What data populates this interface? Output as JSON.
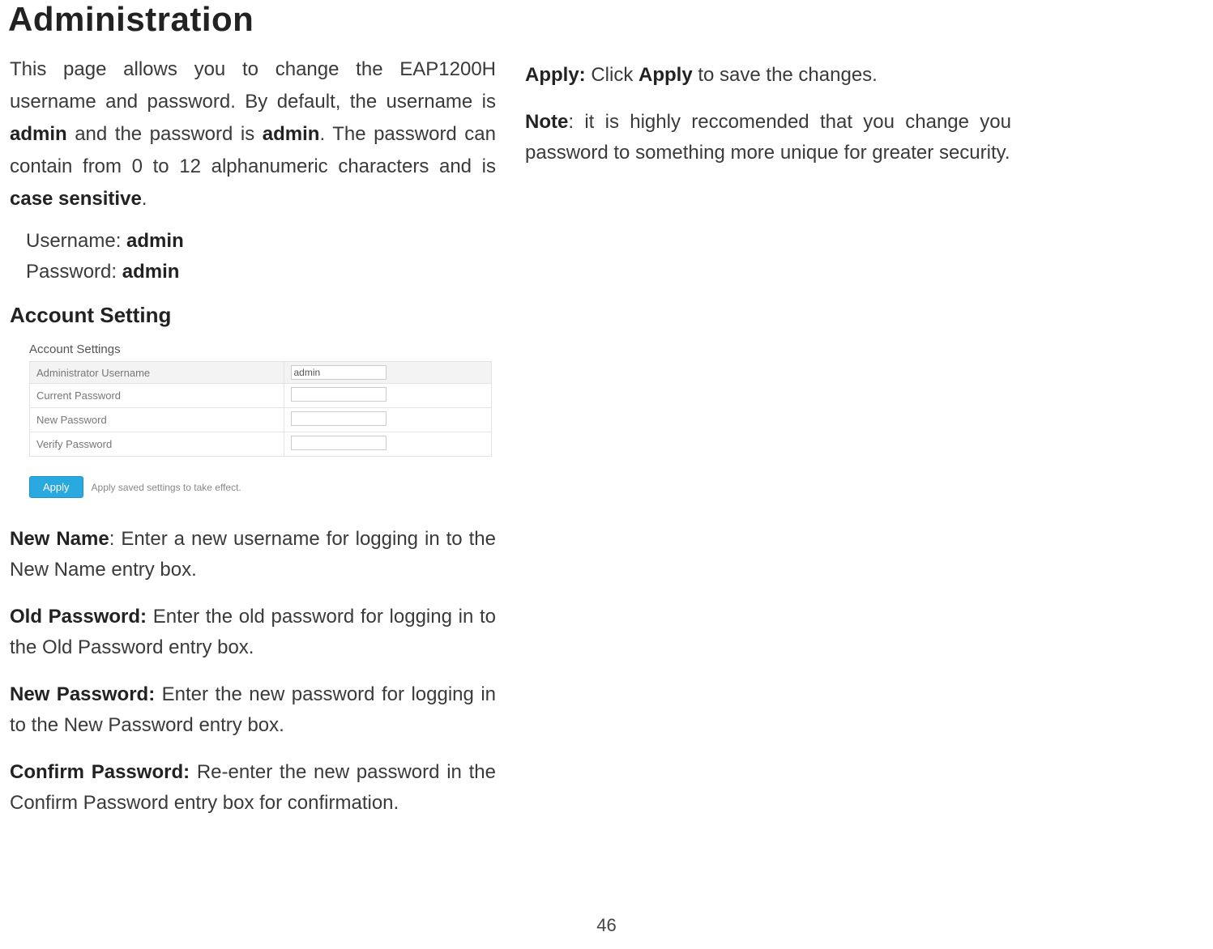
{
  "page": {
    "number": "46",
    "title": "Administration"
  },
  "intro": {
    "pre": "This page allows you to change the EAP1200H username and password. By default, the username is ",
    "b1": "admin",
    "mid1": " and the password is ",
    "b2": "admin",
    "mid2": ". The password can contain from 0 to 12 alphanumeric characters and is ",
    "b3": "case sensitive",
    "end": "."
  },
  "credentials": {
    "username_label": "Username: ",
    "username_value": "admin",
    "password_label": "Password: ",
    "password_value": "admin"
  },
  "section_heading": "Account Setting",
  "screenshot": {
    "title": "Account Settings",
    "rows": {
      "admin_user": {
        "label": "Administrator Username",
        "value": "admin"
      },
      "current_pw": {
        "label": "Current Password",
        "value": ""
      },
      "new_pw": {
        "label": "New Password",
        "value": ""
      },
      "verify_pw": {
        "label": "Verify Password",
        "value": ""
      }
    },
    "apply_button": "Apply",
    "apply_hint": "Apply saved settings to take effect."
  },
  "definitions": {
    "new_name": {
      "label": "New Name",
      "sep": ": ",
      "text": "Enter a new username for logging in to the New Name entry box."
    },
    "old_pw": {
      "label": "Old Password:",
      "sep": " ",
      "text": "Enter the old password for logging in to the Old Password entry box."
    },
    "new_pw": {
      "label": "New Password:",
      "sep": " ",
      "text": "Enter the new password for logging in to the New Password entry box."
    },
    "confirm": {
      "label": "Confirm Password:",
      "sep": " ",
      "text": "Re-enter the new password in the Confirm Password entry box for confirmation."
    }
  },
  "right_col": {
    "apply": {
      "label": "Apply:",
      "pre": " Click ",
      "b": "Apply",
      "post": " to save the changes."
    },
    "note": {
      "label": "Note",
      "sep": ": ",
      "text": "it is highly reccomended that you change you password to something more unique for greater security."
    }
  }
}
